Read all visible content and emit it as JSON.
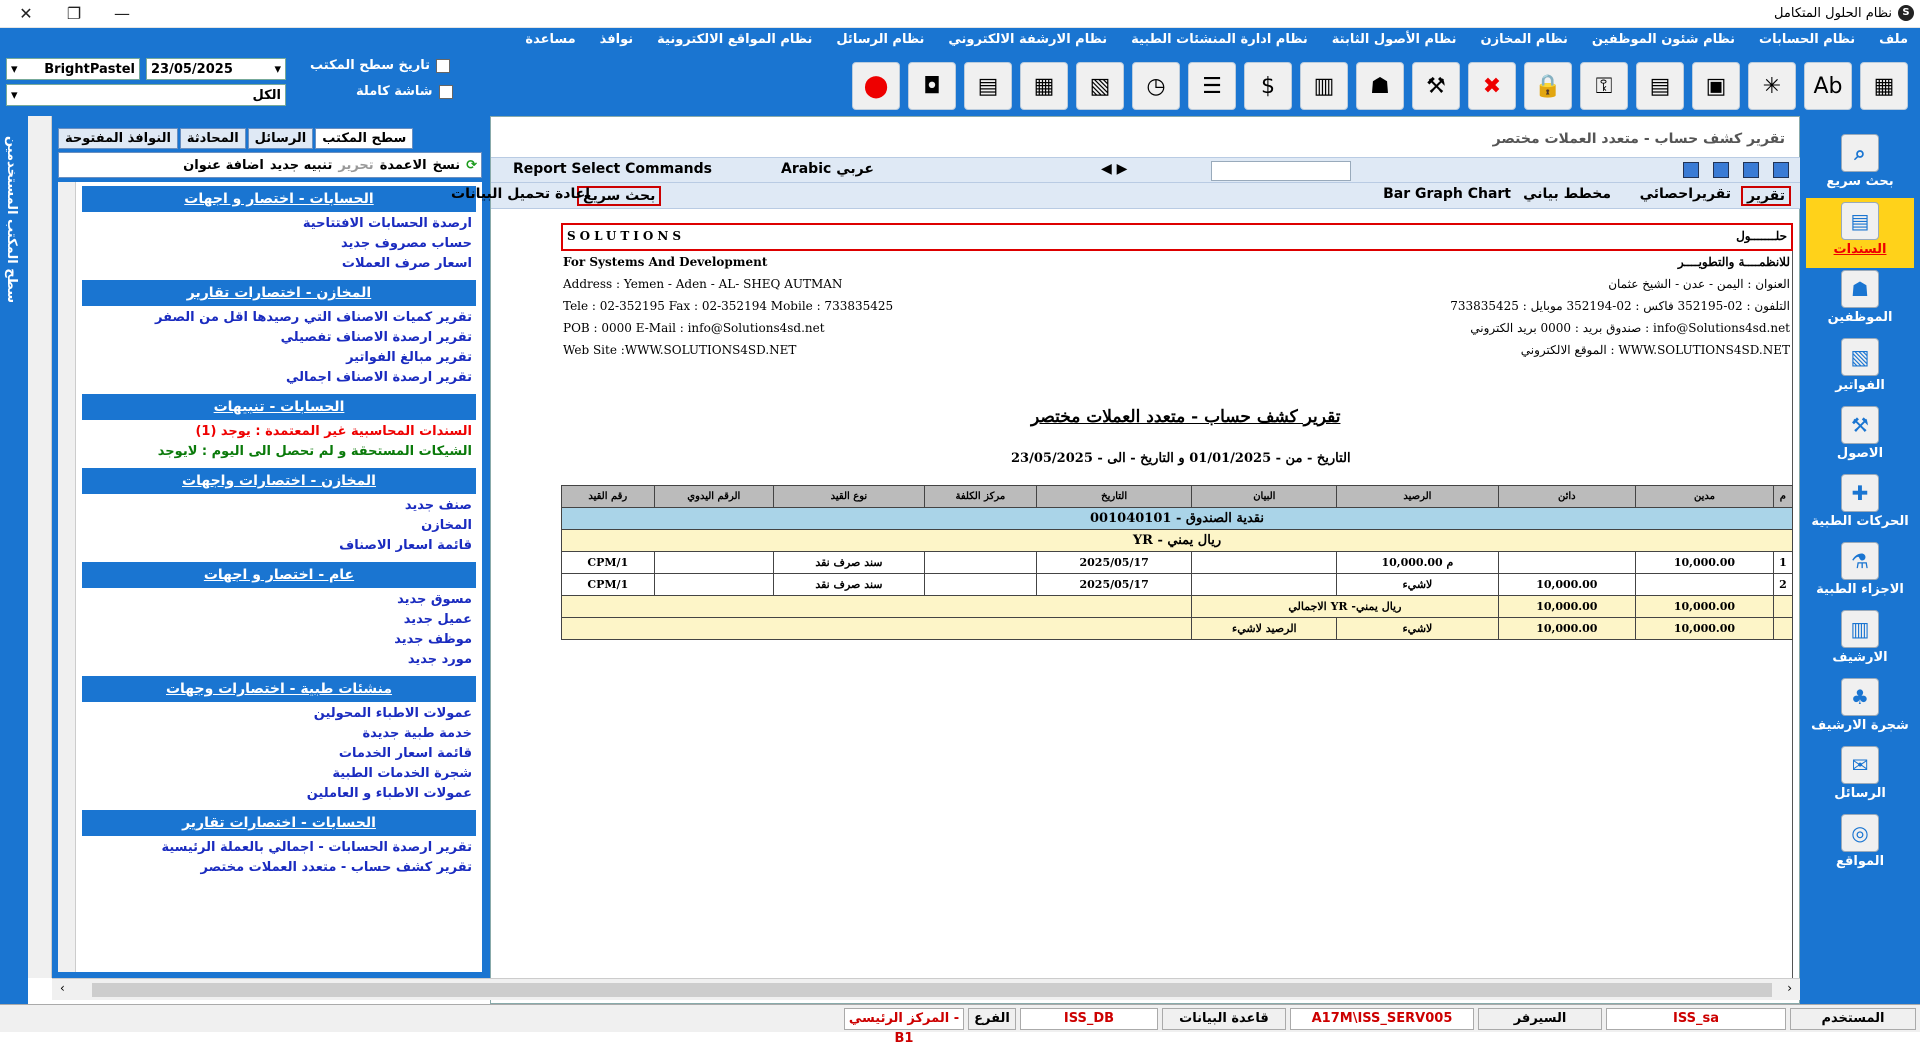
{
  "app": {
    "title": "نظام الحلول المتكامل"
  },
  "menu": [
    "ملف",
    "نظام الحسابات",
    "نظام شئون الموظفين",
    "نظام المخازن",
    "نظام الأصول الثابتة",
    "نظام ادارة المنشئات الطبية",
    "نظام الارشفة الالكتروني",
    "نظام الرسائل",
    "نظام المواقع الالكترونية",
    "نوافذ",
    "مساعدة"
  ],
  "controls": {
    "desktop_date_label": "تاريخ سطح المكتب",
    "fullscreen_label": "شاشة كاملة",
    "date_value": "23/05/2025",
    "theme_value": "BrightPastel",
    "filter_value": "الكل"
  },
  "left_vertical_tab": "سطح المكتب      المستخدمين",
  "panel": {
    "tabs": [
      "سطح المكتب",
      "الرسائل",
      "المحادثة",
      "النوافذ المفتوحة"
    ],
    "actions": [
      "نسخ",
      "الاعمدة",
      "تحرير",
      "تنبيه جديد",
      "اضافة عنوان"
    ],
    "groups": [
      {
        "title": "الحسابات - اختصار و اجهات",
        "items": [
          "ارصدة الحسابات الافتتاحية",
          "حساب مصروف جديد",
          "اسعار صرف العملات"
        ]
      },
      {
        "title": "المخازن - اختصارات تقارير",
        "items": [
          "تقرير كميات الاصناف التي رصيدها اقل من الصفر",
          "تقرير ارصدة الاصناف تفصيلي",
          "تقرير مبالغ الفواتير",
          "تقرير ارصدة الاصناف اجمالي"
        ]
      },
      {
        "title": "الحسابات - تنبيهات",
        "items": [
          "السندات المحاسبية غير المعتمدة : يوجد (1)",
          "الشيكات المستحقة و لم تحصل الى اليوم : لايوجد"
        ]
      },
      {
        "title": "المخازن - اختصارات واجهات",
        "items": [
          "صنف جديد",
          "المخازن",
          "قائمة اسعار الاصناف"
        ]
      },
      {
        "title": "عام - اختصار و اجهات",
        "items": [
          "مسوق جديد",
          "عميل جديد",
          "موظف جديد",
          "مورد جديد"
        ]
      },
      {
        "title": "منشئات طبية - اختصارات وجهات",
        "items": [
          "عمولات الاطباء المحولين",
          "خدمة طبية جديدة",
          "قائمة اسعار الخدمات",
          "شجرة الخدمات الطبية",
          "عمولات الاطباء و العاملين"
        ]
      },
      {
        "title": "الحسابات - اختصارات تقارير",
        "items": [
          "تقرير ارصدة الحسابات - اجمالي بالعملة الرئيسية",
          "تقرير كشف حساب - متعدد العملات مختصر"
        ]
      }
    ]
  },
  "report": {
    "window_title": "تقرير كشف حساب - متعدد العملات مختصر",
    "bar1": {
      "select_commands": "Report Select Commands",
      "language": "Arabic عربي"
    },
    "bar2": {
      "report_btn": "تقرير",
      "stats_btn": "تقريراحصائي",
      "chart_btn": "مخطط بياني",
      "chart_type": "Bar Graph Chart",
      "quick_search": "بحث سريع",
      "reload": "اعادة تحميل البيانات"
    },
    "company_en": "SOLUTIONS",
    "company_ar": "حلـــــــول",
    "sub_en": "For Systems And Development",
    "sub_ar": "للانظمــــة والتطويــــر",
    "address_en": "Address : Yemen - Aden  - AL- SHEQ AUTMAN",
    "address_ar": "العنوان : اليمن - عدن - الشيخ عثمان",
    "tel_en": "Tele : 02-352195  Fax : 02-352194  Mobile : 733835425",
    "tel_ar": "التلفون : 02-352195 فاكس : 02-352194 موبايل : 733835425",
    "pob_en": "POB : 0000  E-Mail : info@Solutions4sd.net",
    "pob_ar": "صندوق بريد : 0000 بريد الكتروني : info@Solutions4sd.net",
    "web_en": "Web Site :WWW.SOLUTIONS4SD.NET",
    "web_ar": "الموقع الالكتروني : WWW.SOLUTIONS4SD.NET",
    "heading": "تقرير كشف حساب - متعدد العملات مختصر",
    "period": "التاريخ - من - 01/01/2025 و التاريخ - الى - 23/05/2025",
    "columns": [
      "م",
      "مدين",
      "دائن",
      "الرصيد",
      "البيان",
      "التاريخ",
      "مركز الكلفة",
      "نوع القيد",
      "الرقم اليدوي",
      "رقم القيد"
    ],
    "account": "001040101 - نقدية الصندوق",
    "currency": "YR - ريال يمني",
    "rows": [
      {
        "n": "1",
        "debit": "10,000.00",
        "credit": "",
        "balance": "10,000.00 م",
        "desc": "",
        "date": "2025/05/17",
        "cost": "",
        "type": "سند صرف نقد",
        "manual": "",
        "entry": "CPM/1"
      },
      {
        "n": "2",
        "debit": "",
        "credit": "10,000.00",
        "balance": "لاشيء",
        "desc": "",
        "date": "2025/05/17",
        "cost": "",
        "type": "سند صرف نقد",
        "manual": "",
        "entry": "CPM/1"
      }
    ],
    "total_label": "الاجمالي YR -ريال يمني",
    "total_debit": "10,000.00",
    "total_credit": "10,000.00",
    "final_label": "الرصيد لاشيء",
    "final_debit": "10,000.00",
    "final_credit": "10,000.00",
    "final_balance": "لاشيء"
  },
  "sidebar": [
    "بحث سريع",
    "السندات",
    "الموظفين",
    "الفواتير",
    "الاصول",
    "الحركات الطبية",
    "الاجزاء الطبية",
    "الارشيف",
    "شجرة الارشيف",
    "الرسائل",
    "المواقع"
  ],
  "status": {
    "user_label": "المستخدم",
    "user": "ISS_sa",
    "server_label": "السيرفر",
    "server": "A17M\\ISS_SERV005",
    "db_label": "قاعدة البيانات",
    "db": "ISS_DB",
    "branch_label": "الفرع",
    "branch": "المركز الرئيسي - B1"
  },
  "colors": {
    "band": "#1a75d1",
    "active_side": "#ffd21a",
    "alert": "#e00000"
  }
}
